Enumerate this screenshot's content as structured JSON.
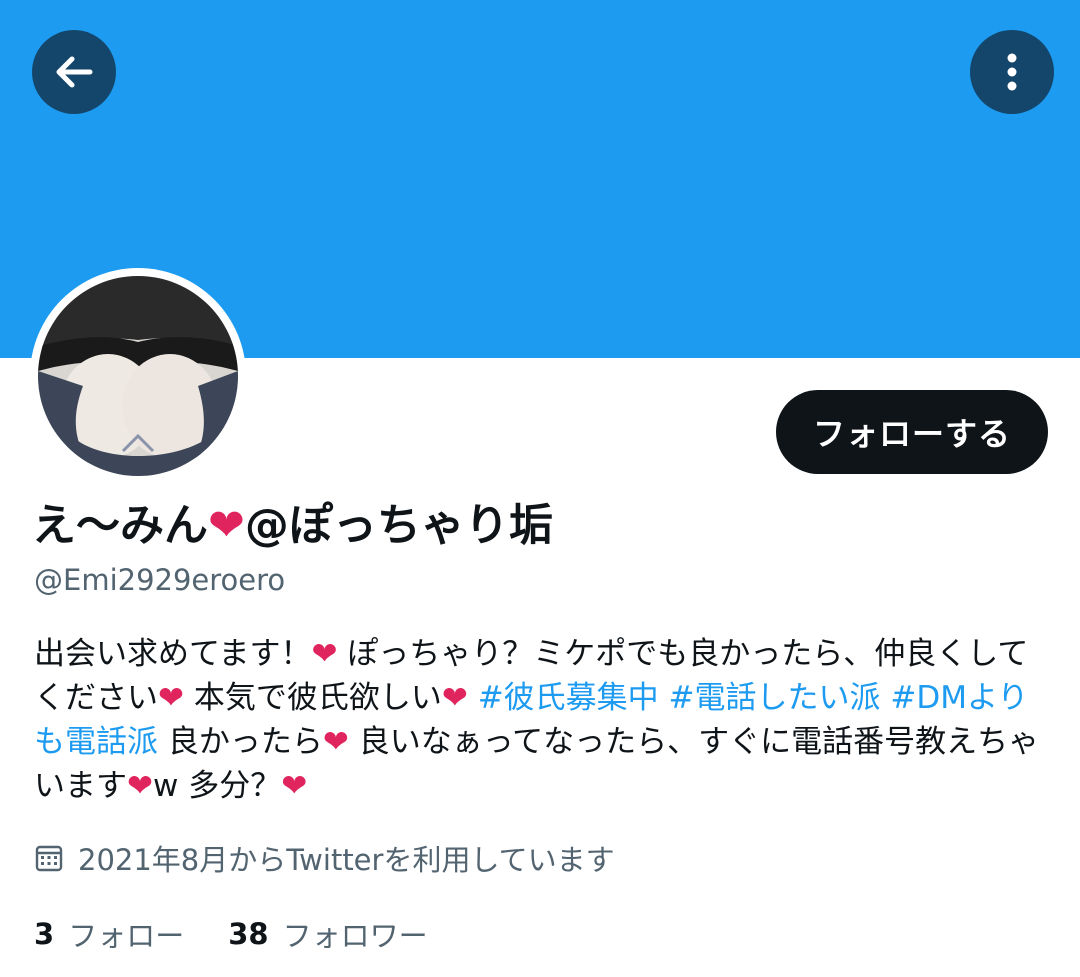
{
  "header": {
    "back_icon": "arrow-left-icon",
    "more_icon": "more-vertical-icon"
  },
  "profile": {
    "follow_label": "フォローする",
    "display_name_part1": "え〜みん",
    "display_name_heart": "❤",
    "display_name_part2": "@ぽっちゃり垢",
    "handle": "@Emi2929eroero",
    "bio": {
      "t1": "出会い求めてます！",
      "t2": " ぽっちゃり？ミケポでも良かったら、仲良くしてください",
      "t3": " 本気で彼氏欲しい",
      "tag1": "#彼氏募集中",
      "tag2": "#電話したい派",
      "tag3": "#DMよりも電話派",
      "t4": " 良かったら",
      "t5": " 良いなぁってなったら、すぐに電話番号教えちゃいます",
      "t6": "w 多分？",
      "heart": "❤"
    },
    "joined": "2021年8月からTwitterを利用しています",
    "following_count": "3",
    "following_label": "フォロー",
    "followers_count": "38",
    "followers_label": "フォロワー"
  },
  "colors": {
    "banner": "#1d9bf0",
    "link": "#1d9bf0",
    "heart": "#e0245e",
    "secondary_text": "#536471"
  }
}
